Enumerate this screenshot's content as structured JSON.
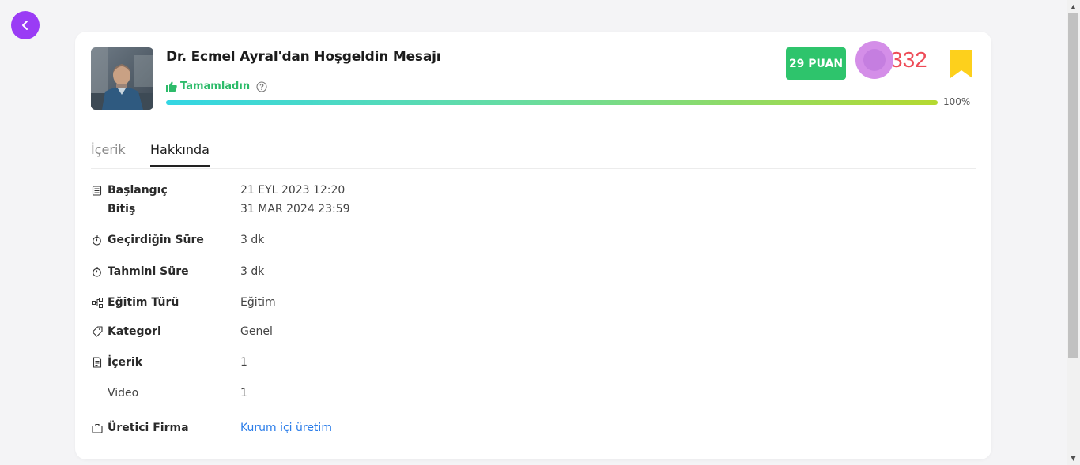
{
  "header": {
    "title": "Dr. Ecmel Ayral'dan Hoşgeldin Mesajı",
    "status_label": "Tamamladın",
    "progress": 1.0,
    "progress_label": "100%",
    "points_label": "29 PUAN",
    "likes_count": "332"
  },
  "tabs": [
    {
      "label": "İçerik",
      "active": false
    },
    {
      "label": "Hakkında",
      "active": true
    }
  ],
  "details": {
    "start_label": "Başlangıç",
    "start_value": "21 EYL 2023 12:20",
    "end_label": "Bitiş",
    "end_value": "31 MAR 2024 23:59",
    "spent_label": "Geçirdiğin Süre",
    "spent_value": "3 dk",
    "estimated_label": "Tahmini Süre",
    "estimated_value": "3 dk",
    "type_label": "Eğitim Türü",
    "type_value": "Eğitim",
    "category_label": "Kategori",
    "category_value": "Genel",
    "content_label": "İçerik",
    "content_value": "1",
    "video_label": "Video",
    "video_value": "1",
    "producer_label": "Üretici Firma",
    "producer_value": "Kurum içi üretim"
  },
  "colors": {
    "accent_purple": "#9a3cf5",
    "success_green": "#2ec46c",
    "likes_red": "#ee4b57",
    "bookmark_yellow": "#fdd01c",
    "link_blue": "#2b7de9"
  },
  "icons": {
    "back": "chevron-left-icon",
    "status": "thumbs-up-icon",
    "help": "question-circle-icon",
    "bookmark": "bookmark-icon",
    "dates": "calendar-list-icon",
    "time": "stopwatch-icon",
    "type": "sitemap-icon",
    "category": "tag-icon",
    "content": "document-icon",
    "producer": "briefcase-icon"
  }
}
